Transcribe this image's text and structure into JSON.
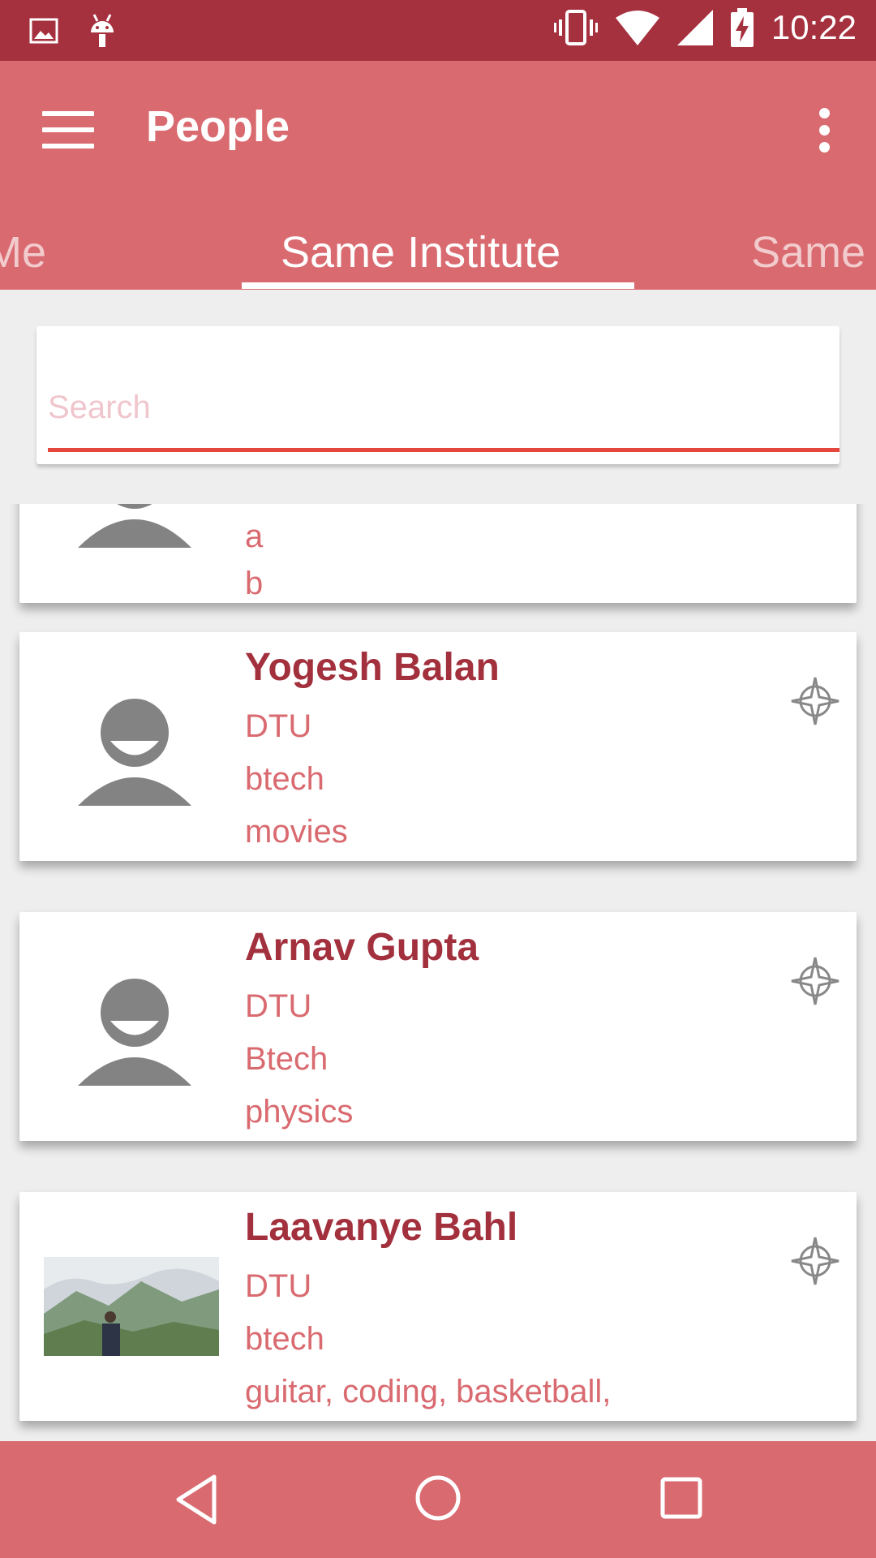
{
  "status_bar": {
    "left_icons": [
      "image-icon",
      "android-icon"
    ],
    "right_icons": [
      "vibrate-icon",
      "wifi-icon",
      "signal-icon",
      "battery-charging-icon"
    ],
    "time": "10:22"
  },
  "app_bar": {
    "title": "People",
    "menu_icon": "hamburger-icon",
    "more_icon": "overflow-icon",
    "color": "#d96a70"
  },
  "tabs": [
    {
      "label": "Near Me",
      "active": false
    },
    {
      "label": "Same Institute",
      "active": true
    },
    {
      "label": "Same",
      "active": false
    }
  ],
  "search": {
    "placeholder": "Search",
    "value": ""
  },
  "people": [
    {
      "name": "",
      "line1": "",
      "line2": "a",
      "line3": "b",
      "avatar": "default-avatar"
    },
    {
      "name": "Yogesh Balan",
      "line1": "DTU",
      "line2": "btech",
      "line3": "movies",
      "avatar": "default-avatar"
    },
    {
      "name": "Arnav Gupta",
      "line1": "DTU",
      "line2": "Btech",
      "line3": "physics",
      "avatar": "default-avatar"
    },
    {
      "name": "Laavanye Bahl",
      "line1": "DTU",
      "line2": "btech",
      "line3": "guitar, coding, basketball,",
      "avatar": "photo"
    }
  ],
  "nav_bar": {
    "icons": [
      "back-icon",
      "home-icon",
      "recents-icon"
    ]
  },
  "colors": {
    "primary_dark": "#a5303e",
    "primary": "#d96a70",
    "name_text": "#a2303d",
    "accent_underline": "#e5473f"
  }
}
